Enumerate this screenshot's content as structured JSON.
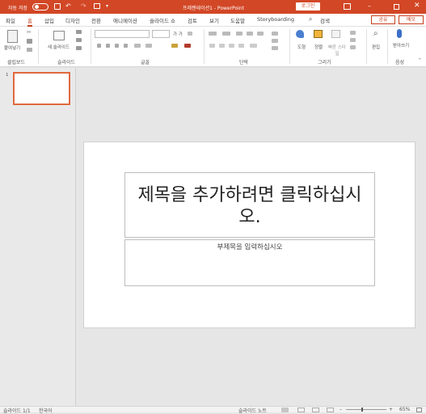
{
  "titlebar": {
    "autosave_label": "자동 저장",
    "autosave_state": "끔",
    "doc_title": "프레젠테이션1 - PowerPoint",
    "login_button": "로그인",
    "search_label": "검색",
    "share_button": "공유",
    "comments_button": "메모"
  },
  "tabs": [
    "파일",
    "홈",
    "삽입",
    "디자인",
    "전환",
    "애니메이션",
    "슬라이드 쇼",
    "검토",
    "보기",
    "도움말",
    "Storyboarding"
  ],
  "active_tab": "홈",
  "ribbon": {
    "clipboard": {
      "paste_label": "붙여넣기",
      "group_label": "클립보드"
    },
    "slides": {
      "new_slide_label": "새 슬라이드",
      "group_label": "슬라이드"
    },
    "font": {
      "font_size_buttons": "가 가",
      "group_label": "글꼴"
    },
    "paragraph": {
      "group_label": "단락"
    },
    "drawing": {
      "shape_label": "도형",
      "arrange_label": "정렬",
      "quick_styles_label": "빠른 스타일",
      "group_label": "그리기"
    },
    "editing": {
      "label": "편집"
    },
    "voice": {
      "dictate_label": "받아쓰기",
      "group_label": "음성"
    }
  },
  "thumbnail": {
    "number": "1"
  },
  "slide": {
    "title_placeholder": "제목을 추가하려면 클릭하십시오.",
    "subtitle_placeholder": "부제목을 입력하십시오"
  },
  "status": {
    "slide_info": "슬라이드 1/1",
    "language": "한국어",
    "notes_label": "슬라이드 노트",
    "zoom": "65%"
  },
  "colors": {
    "accent": "#d24726",
    "active_tab": "#c43e1c",
    "thumb_selected": "#e0693f"
  }
}
